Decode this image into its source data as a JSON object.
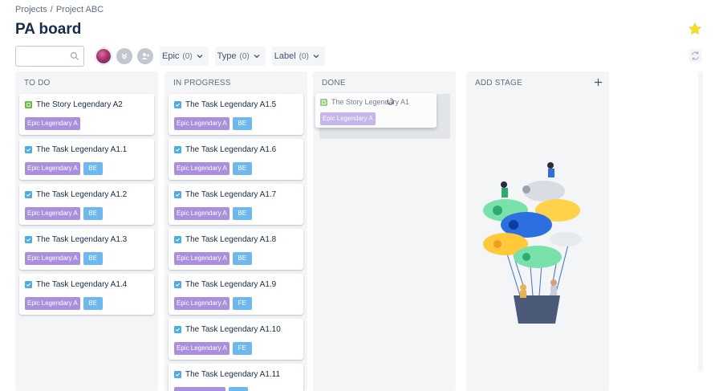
{
  "breadcrumb": [
    "Projects",
    "/",
    "Project ABC"
  ],
  "page_title": "PA board",
  "search": {
    "placeholder": "",
    "value": ""
  },
  "filters": [
    {
      "label": "Epic",
      "count": "(0)"
    },
    {
      "label": "Type",
      "count": "(0)"
    },
    {
      "label": "Label",
      "count": "(0)"
    }
  ],
  "columns": {
    "todo": {
      "title": "TO DO",
      "cards": [
        {
          "title": "The Story Legendary A2",
          "type": "story",
          "epic": "Epic Legendary A",
          "team": ""
        },
        {
          "title": "The Task Legendary A1.1",
          "type": "task",
          "epic": "Epic Legendary A",
          "team": "BE"
        },
        {
          "title": "The Task Legendary A1.2",
          "type": "task",
          "epic": "Epic Legendary A",
          "team": "BE"
        },
        {
          "title": "The Task Legendary A1.3",
          "type": "task",
          "epic": "Epic Legendary A",
          "team": "BE"
        },
        {
          "title": "The Task Legendary A1.4",
          "type": "task",
          "epic": "Epic Legendary A",
          "team": "BE"
        }
      ]
    },
    "inprogress": {
      "title": "IN PROGRESS",
      "cards": [
        {
          "title": "The Task Legendary A1.5",
          "type": "task",
          "epic": "Epic Legendary A",
          "team": "BE"
        },
        {
          "title": "The Task Legendary A1.6",
          "type": "task",
          "epic": "Epic Legendary A",
          "team": "BE"
        },
        {
          "title": "The Task Legendary A1.7",
          "type": "task",
          "epic": "Epic Legendary A",
          "team": "BE"
        },
        {
          "title": "The Task Legendary A1.8",
          "type": "task",
          "epic": "Epic Legendary A",
          "team": "BE"
        },
        {
          "title": "The Task Legendary A1.9",
          "type": "task",
          "epic": "Epic Legendary A",
          "team": "FE"
        },
        {
          "title": "The Task Legendary A1.10",
          "type": "task",
          "epic": "Epic Legendary A",
          "team": "FE"
        },
        {
          "title": "The Task Legendary A1.11",
          "type": "task",
          "epic": "",
          "team": ""
        }
      ]
    },
    "done": {
      "title": "DONE",
      "dragging_card": {
        "title": "The Story Legendary A1",
        "type": "story",
        "epic": "Epic Legendary A"
      }
    },
    "add_stage": {
      "title": "ADD STAGE"
    }
  },
  "icons": [
    "search-icon",
    "star-icon",
    "chevron-down-icon",
    "add-user-icon",
    "refresh-icon",
    "plus-icon",
    "checkbox-icon",
    "story-icon"
  ],
  "colors": {
    "column_bg": "#f4f5f7",
    "task_icon": "#4bade8",
    "story_icon": "#63ba3c",
    "epic_tag": "#a98fdc",
    "team_tag": "#6cb8ef",
    "star": "#f7e11b"
  }
}
